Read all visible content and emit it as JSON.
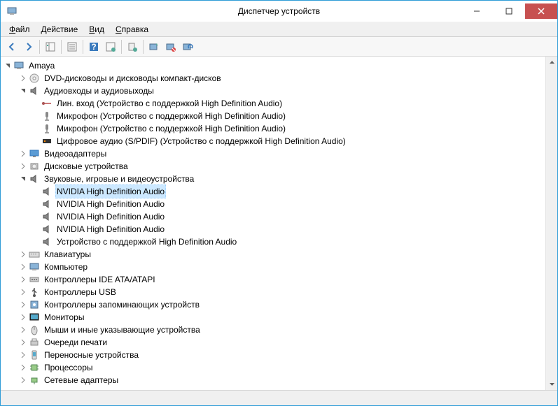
{
  "title": "Диспетчер устройств",
  "menu": {
    "file": "Файл",
    "action": "Действие",
    "view": "Вид",
    "help": "Справка"
  },
  "tree": {
    "root": {
      "label": "Amaya",
      "icon": "computer"
    },
    "items": [
      {
        "depth": 1,
        "exp": "closed",
        "icon": "disc",
        "label": "DVD-дисководы и дисководы компакт-дисков",
        "sel": false
      },
      {
        "depth": 1,
        "exp": "open",
        "icon": "speaker",
        "label": "Аудиовходы и аудиовыходы",
        "sel": false
      },
      {
        "depth": 2,
        "exp": "none",
        "icon": "linein",
        "label": "Лин. вход (Устройство с поддержкой High Definition Audio)",
        "sel": false
      },
      {
        "depth": 2,
        "exp": "none",
        "icon": "mic",
        "label": "Микрофон (Устройство с поддержкой High Definition Audio)",
        "sel": false
      },
      {
        "depth": 2,
        "exp": "none",
        "icon": "mic",
        "label": "Микрофон (Устройство с поддержкой High Definition Audio)",
        "sel": false
      },
      {
        "depth": 2,
        "exp": "none",
        "icon": "spdif",
        "label": "Цифровое аудио (S/PDIF) (Устройство с поддержкой High Definition Audio)",
        "sel": false
      },
      {
        "depth": 1,
        "exp": "closed",
        "icon": "display",
        "label": "Видеоадаптеры",
        "sel": false
      },
      {
        "depth": 1,
        "exp": "closed",
        "icon": "disk",
        "label": "Дисковые устройства",
        "sel": false
      },
      {
        "depth": 1,
        "exp": "open",
        "icon": "speaker",
        "label": "Звуковые, игровые и видеоустройства",
        "sel": false
      },
      {
        "depth": 2,
        "exp": "none",
        "icon": "speaker",
        "label": "NVIDIA High Definition Audio",
        "sel": true
      },
      {
        "depth": 2,
        "exp": "none",
        "icon": "speaker",
        "label": "NVIDIA High Definition Audio",
        "sel": false
      },
      {
        "depth": 2,
        "exp": "none",
        "icon": "speaker",
        "label": "NVIDIA High Definition Audio",
        "sel": false
      },
      {
        "depth": 2,
        "exp": "none",
        "icon": "speaker",
        "label": "NVIDIA High Definition Audio",
        "sel": false
      },
      {
        "depth": 2,
        "exp": "none",
        "icon": "speaker",
        "label": "Устройство с поддержкой High Definition Audio",
        "sel": false
      },
      {
        "depth": 1,
        "exp": "closed",
        "icon": "keyboard",
        "label": "Клавиатуры",
        "sel": false
      },
      {
        "depth": 1,
        "exp": "closed",
        "icon": "computer",
        "label": "Компьютер",
        "sel": false
      },
      {
        "depth": 1,
        "exp": "closed",
        "icon": "ide",
        "label": "Контроллеры IDE ATA/ATAPI",
        "sel": false
      },
      {
        "depth": 1,
        "exp": "closed",
        "icon": "usb",
        "label": "Контроллеры USB",
        "sel": false
      },
      {
        "depth": 1,
        "exp": "closed",
        "icon": "storage",
        "label": "Контроллеры запоминающих устройств",
        "sel": false
      },
      {
        "depth": 1,
        "exp": "closed",
        "icon": "monitor",
        "label": "Мониторы",
        "sel": false
      },
      {
        "depth": 1,
        "exp": "closed",
        "icon": "mouse",
        "label": "Мыши и иные указывающие устройства",
        "sel": false
      },
      {
        "depth": 1,
        "exp": "closed",
        "icon": "printer",
        "label": "Очереди печати",
        "sel": false
      },
      {
        "depth": 1,
        "exp": "closed",
        "icon": "portable",
        "label": "Переносные устройства",
        "sel": false
      },
      {
        "depth": 1,
        "exp": "closed",
        "icon": "cpu",
        "label": "Процессоры",
        "sel": false
      },
      {
        "depth": 1,
        "exp": "closed",
        "icon": "network",
        "label": "Сетевые адаптеры",
        "sel": false
      }
    ]
  },
  "toolbar_icons": [
    "back",
    "forward",
    "sep",
    "show-hide-tree",
    "sep",
    "properties",
    "sep",
    "help",
    "refresh",
    "sep",
    "update-driver",
    "sep",
    "uninstall",
    "disable",
    "scan-hardware"
  ]
}
